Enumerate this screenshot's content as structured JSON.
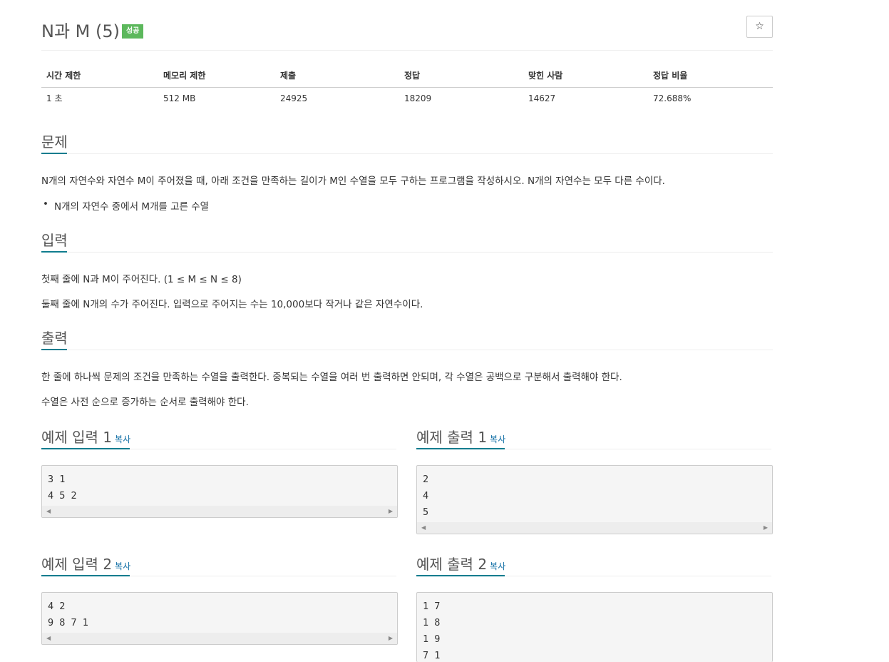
{
  "title": "N과 M (5)",
  "badge": "성공",
  "star_icon": "☆",
  "info": {
    "headers": [
      "시간 제한",
      "메모리 제한",
      "제출",
      "정답",
      "맞힌 사람",
      "정답 비율"
    ],
    "values": [
      "1 초",
      "512 MB",
      "24925",
      "18209",
      "14627",
      "72.688%"
    ]
  },
  "sections": {
    "problem": {
      "title": "문제",
      "text": "N개의 자연수와 자연수 M이 주어졌을 때, 아래 조건을 만족하는 길이가 M인 수열을 모두 구하는 프로그램을 작성하시오. N개의 자연수는 모두 다른 수이다.",
      "bullet": "N개의 자연수 중에서 M개를 고른 수열"
    },
    "input": {
      "title": "입력",
      "lines": [
        "첫째 줄에 N과 M이 주어진다. (1 ≤ M ≤ N ≤ 8)",
        "둘째 줄에 N개의 수가 주어진다. 입력으로 주어지는 수는 10,000보다 작거나 같은 자연수이다."
      ]
    },
    "output": {
      "title": "출력",
      "lines": [
        "한 줄에 하나씩 문제의 조건을 만족하는 수열을 출력한다. 중복되는 수열을 여러 번 출력하면 안되며, 각 수열은 공백으로 구분해서 출력해야 한다.",
        "수열은 사전 순으로 증가하는 순서로 출력해야 한다."
      ]
    }
  },
  "copy_label": "복사",
  "samples": {
    "input1": {
      "title": "예제 입력 1",
      "content": "3 1\n4 5 2"
    },
    "output1": {
      "title": "예제 출력 1",
      "content": "2\n4\n5"
    },
    "input2": {
      "title": "예제 입력 2",
      "content": "4 2\n9 8 7 1"
    },
    "output2": {
      "title": "예제 출력 2",
      "content": "1 7\n1 8\n1 9\n7 1"
    }
  },
  "scroll_left_icon": "◀",
  "scroll_right_icon": "▶"
}
